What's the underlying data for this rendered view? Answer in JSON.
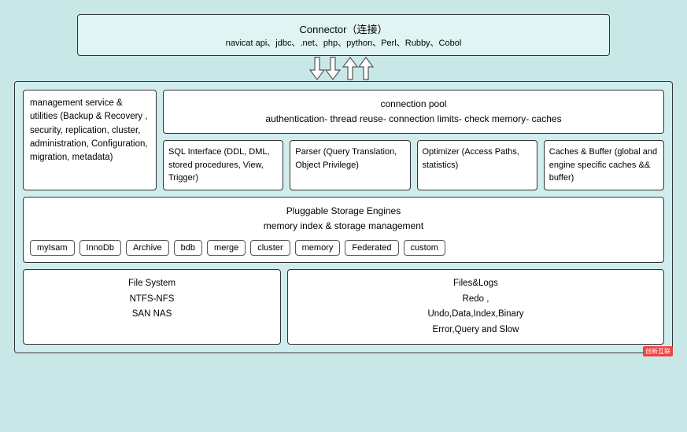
{
  "connector": {
    "title": "Connector（连接）",
    "subtitle": "navicat api、jdbc、.net、php、python、Perl、Rubby、Cobol"
  },
  "management": {
    "text": "management service & utilities (Backup & Recovery , security, replication, cluster, administration, Configuration, migration, metadata)"
  },
  "connectionPool": {
    "line1": "connection pool",
    "line2": "authentication- thread reuse- connection limits- check memory- caches"
  },
  "innerBoxes": [
    {
      "title": "SQL Interface (DDL, DML, stored procedures, View, Trigger)"
    },
    {
      "title": "Parser (Query Translation, Object Privilege)"
    },
    {
      "title": "Optimizer (Access Paths, statistics)"
    },
    {
      "title": "Caches & Buffer (global and engine specific caches && buffer)"
    }
  ],
  "storage": {
    "line1": "Pluggable Storage Engines",
    "line2": "memory index & storage management",
    "engines": [
      "myIsam",
      "InnoDb",
      "Archive",
      "bdb",
      "merge",
      "cluster",
      "memory",
      "Federated",
      "custom"
    ]
  },
  "filesystem": {
    "line1": "File System",
    "line2": "NTFS-NFS",
    "line3": "SAN NAS"
  },
  "filesLogs": {
    "line1": "Files&Logs",
    "line2": "Redo ,",
    "line3": "Undo,Data,Index,Binary",
    "line4": "Error,Query and Slow"
  },
  "watermark": {
    "text": "创新互联"
  }
}
